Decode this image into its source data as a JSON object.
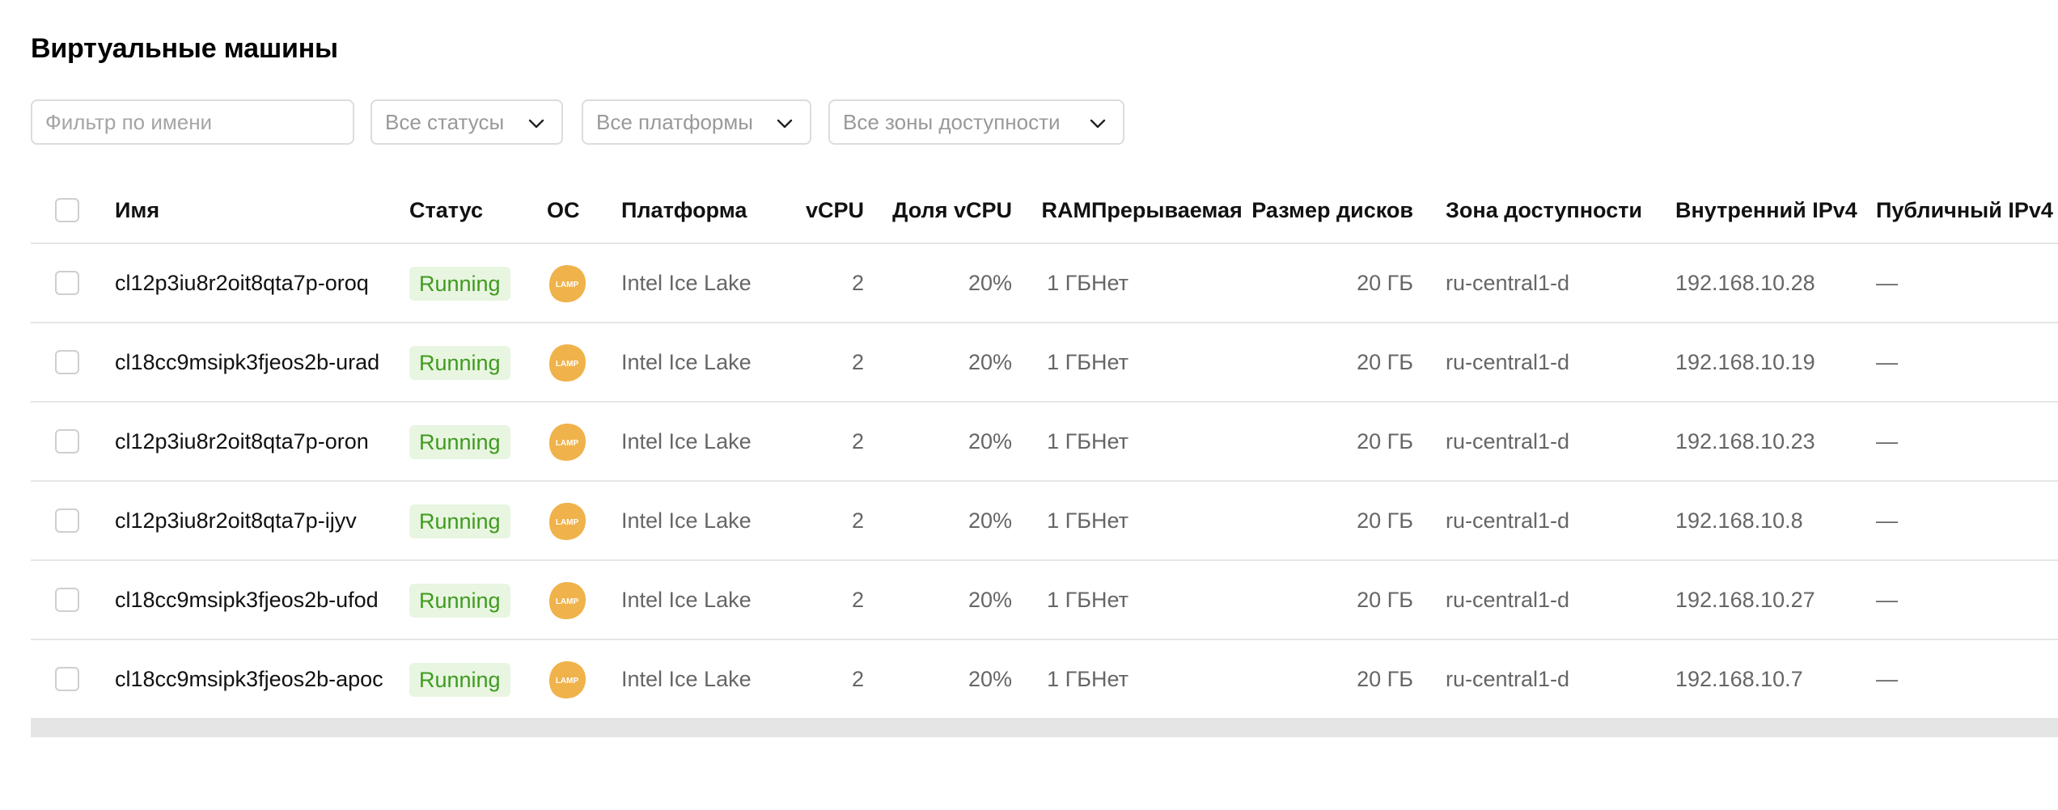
{
  "page": {
    "title": "Виртуальные машины"
  },
  "filters": {
    "name_placeholder": "Фильтр по имени",
    "status_select": "Все статусы",
    "platform_select": "Все платформы",
    "zone_select": "Все зоны доступности"
  },
  "table": {
    "headers": {
      "name": "Имя",
      "status": "Статус",
      "os": "ОС",
      "platform": "Платформа",
      "vcpu": "vCPU",
      "vcpu_share": "Доля vCPU",
      "ram": "RAM",
      "preemptible": "Прерываемая",
      "disk_size": "Размер дисков",
      "zone": "Зона доступности",
      "internal_ip": "Внутренний IPv4",
      "public_ip": "Публичный IPv4"
    },
    "rows": [
      {
        "name": "cl12p3iu8r2oit8qta7p-oroq",
        "status": "Running",
        "os": "LAMP",
        "platform": "Intel Ice Lake",
        "vcpu": "2",
        "vcpu_share": "20%",
        "ram": "1 ГБ",
        "preemptible": "Нет",
        "disk_size": "20 ГБ",
        "zone": "ru-central1-d",
        "internal_ip": "192.168.10.28",
        "public_ip": "—"
      },
      {
        "name": "cl18cc9msipk3fjeos2b-urad",
        "status": "Running",
        "os": "LAMP",
        "platform": "Intel Ice Lake",
        "vcpu": "2",
        "vcpu_share": "20%",
        "ram": "1 ГБ",
        "preemptible": "Нет",
        "disk_size": "20 ГБ",
        "zone": "ru-central1-d",
        "internal_ip": "192.168.10.19",
        "public_ip": "—"
      },
      {
        "name": "cl12p3iu8r2oit8qta7p-oron",
        "status": "Running",
        "os": "LAMP",
        "platform": "Intel Ice Lake",
        "vcpu": "2",
        "vcpu_share": "20%",
        "ram": "1 ГБ",
        "preemptible": "Нет",
        "disk_size": "20 ГБ",
        "zone": "ru-central1-d",
        "internal_ip": "192.168.10.23",
        "public_ip": "—"
      },
      {
        "name": "cl12p3iu8r2oit8qta7p-ijyv",
        "status": "Running",
        "os": "LAMP",
        "platform": "Intel Ice Lake",
        "vcpu": "2",
        "vcpu_share": "20%",
        "ram": "1 ГБ",
        "preemptible": "Нет",
        "disk_size": "20 ГБ",
        "zone": "ru-central1-d",
        "internal_ip": "192.168.10.8",
        "public_ip": "—"
      },
      {
        "name": "cl18cc9msipk3fjeos2b-ufod",
        "status": "Running",
        "os": "LAMP",
        "platform": "Intel Ice Lake",
        "vcpu": "2",
        "vcpu_share": "20%",
        "ram": "1 ГБ",
        "preemptible": "Нет",
        "disk_size": "20 ГБ",
        "zone": "ru-central1-d",
        "internal_ip": "192.168.10.27",
        "public_ip": "—"
      },
      {
        "name": "cl18cc9msipk3fjeos2b-apoc",
        "status": "Running",
        "os": "LAMP",
        "platform": "Intel Ice Lake",
        "vcpu": "2",
        "vcpu_share": "20%",
        "ram": "1 ГБ",
        "preemptible": "Нет",
        "disk_size": "20 ГБ",
        "zone": "ru-central1-d",
        "internal_ip": "192.168.10.7",
        "public_ip": "—"
      }
    ]
  },
  "colors": {
    "status_running_text": "#3f9b1f",
    "status_running_bg": "#e8f5e1",
    "lamp_icon": "#f0b24a"
  },
  "icons": {
    "os": "lamp-icon",
    "dropdown": "chevron-down-icon"
  }
}
